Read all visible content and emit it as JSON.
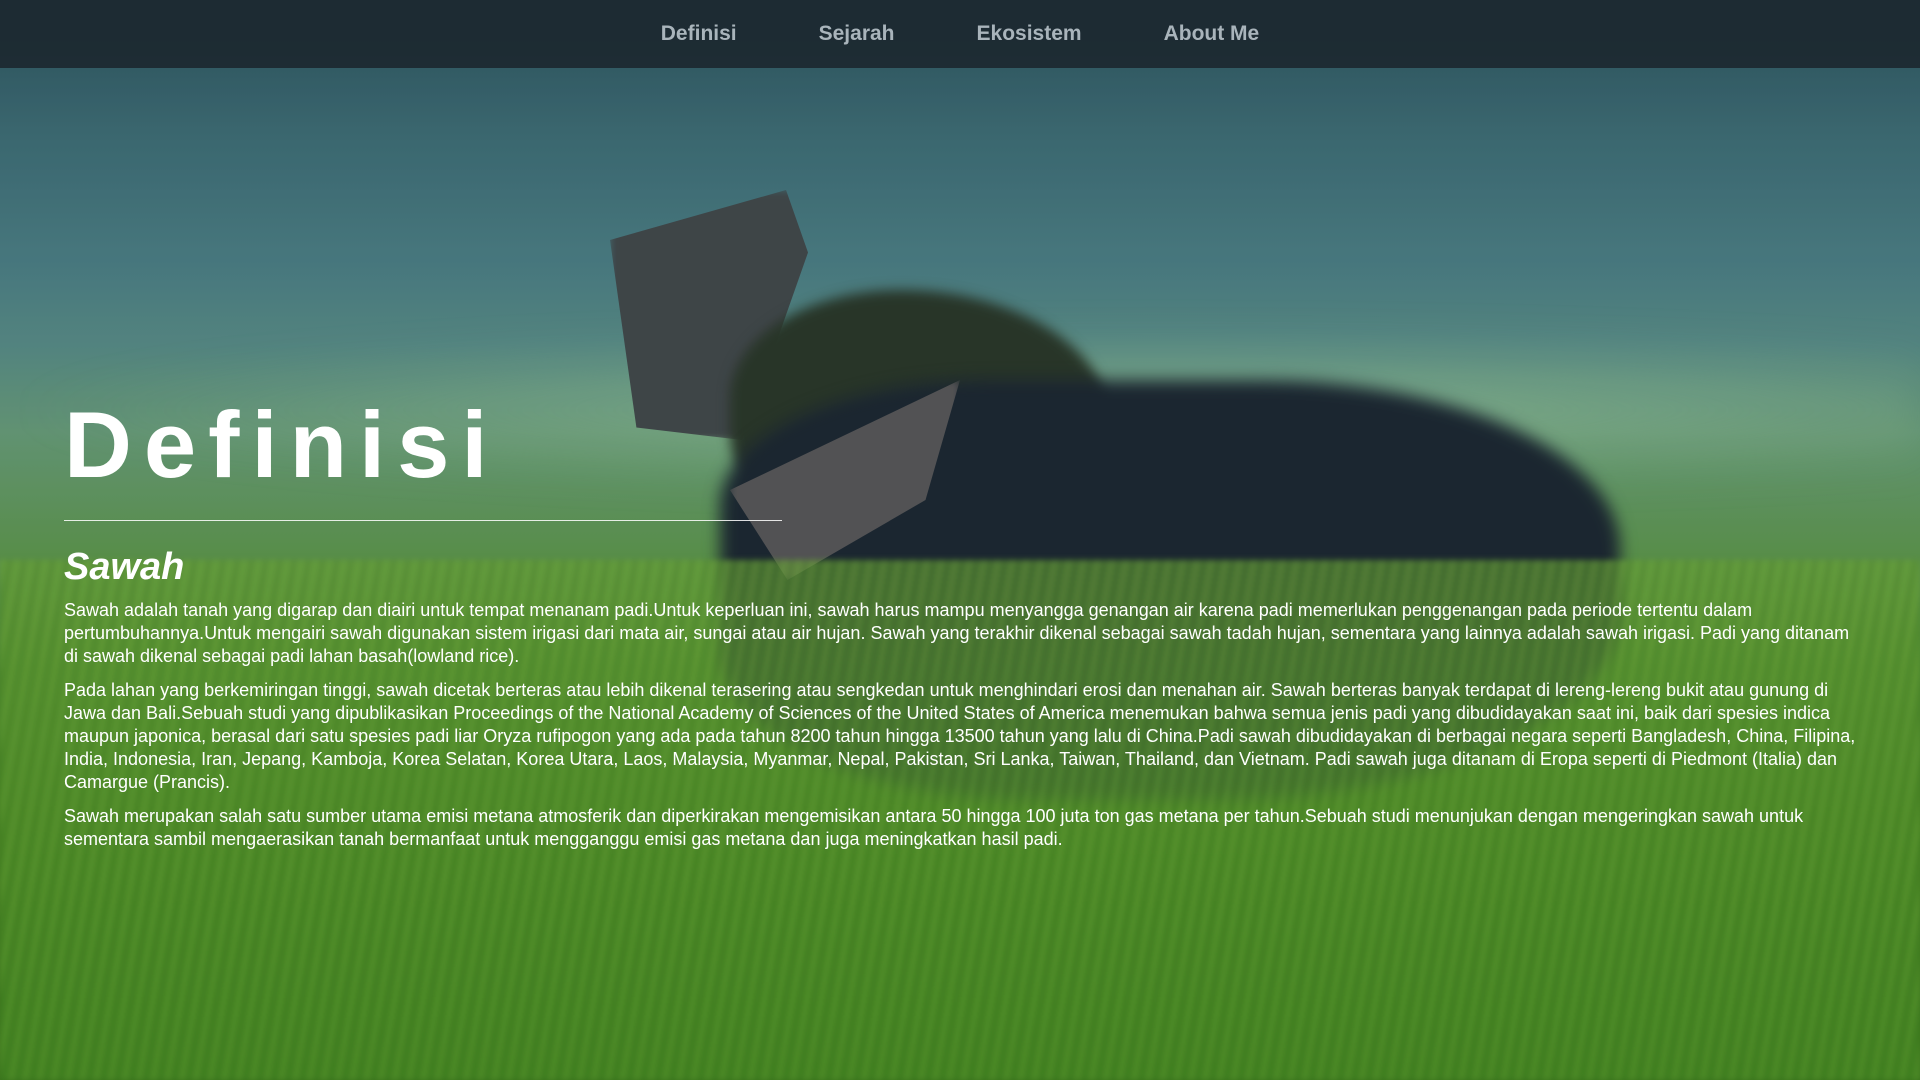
{
  "nav": {
    "items": [
      {
        "label": "Definisi"
      },
      {
        "label": "Sejarah"
      },
      {
        "label": "Ekosistem"
      },
      {
        "label": "About Me"
      }
    ]
  },
  "main": {
    "title": "Definisi",
    "subtitle": "Sawah",
    "paragraphs": [
      "Sawah adalah tanah yang digarap dan diairi untuk tempat menanam padi.Untuk keperluan ini, sawah harus mampu menyangga genangan air karena padi memerlukan penggenangan pada periode tertentu dalam pertumbuhannya.Untuk mengairi sawah digunakan sistem irigasi dari mata air, sungai atau air hujan. Sawah yang terakhir dikenal sebagai sawah tadah hujan, sementara yang lainnya adalah sawah irigasi. Padi yang ditanam di sawah dikenal sebagai padi lahan basah(lowland rice).",
      "Pada lahan yang berkemiringan tinggi, sawah dicetak berteras atau lebih dikenal terasering atau sengkedan untuk menghindari erosi dan menahan air. Sawah berteras banyak terdapat di lereng-lereng bukit atau gunung di Jawa dan Bali.Sebuah studi yang dipublikasikan Proceedings of the National Academy of Sciences of the United States of America menemukan bahwa semua jenis padi yang dibudidayakan saat ini, baik dari spesies indica maupun japonica, berasal dari satu spesies padi liar Oryza rufipogon yang ada pada tahun 8200 tahun hingga 13500 tahun yang lalu di China.Padi sawah dibudidayakan di berbagai negara seperti Bangladesh, China, Filipina, India, Indonesia, Iran, Jepang, Kamboja, Korea Selatan, Korea Utara, Laos, Malaysia, Myanmar, Nepal, Pakistan, Sri Lanka, Taiwan, Thailand, dan Vietnam. Padi sawah juga ditanam di Eropa seperti di Piedmont (Italia) dan Camargue (Prancis).",
      "Sawah merupakan salah satu sumber utama emisi metana atmosferik dan diperkirakan mengemisikan antara 50 hingga 100 juta ton gas metana per tahun.Sebuah studi menunjukan dengan mengeringkan sawah untuk sementara sambil mengaerasikan tanah bermanfaat untuk mengganggu emisi gas metana dan juga meningkatkan hasil padi."
    ]
  },
  "colors": {
    "navbar_bg": "#1c2830",
    "nav_text": "#a9b4bb",
    "content_text": "#ffffff"
  }
}
